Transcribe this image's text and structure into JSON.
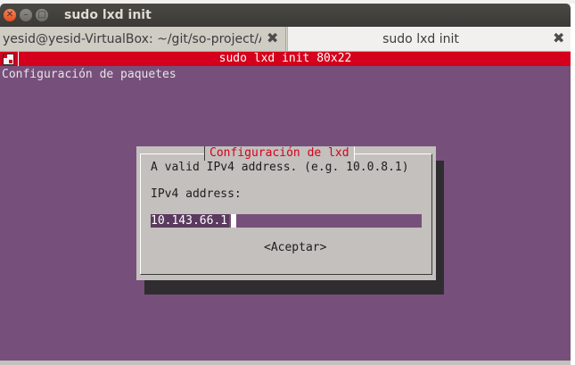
{
  "window": {
    "title": "sudo lxd init",
    "close_glyph": "✕",
    "min_glyph": "–",
    "max_glyph": "□"
  },
  "tabs": [
    {
      "label": "yesid@yesid-VirtualBox: ~/git/so-project/A",
      "close_glyph": "✖"
    },
    {
      "label": "sudo lxd init",
      "close_glyph": "✖"
    }
  ],
  "terminal": {
    "title": "sudo lxd init 80x22",
    "line1": "Configuración de paquetes",
    "colors": {
      "background": "#76507a",
      "titlebar": "#d5001b"
    }
  },
  "dialog": {
    "title": "Configuración de lxd",
    "description": "A valid IPv4 address. (e.g. 10.0.8.1)",
    "field_label": "IPv4 address:",
    "field_value": "10.143.66.1",
    "ok_button": "<Aceptar>"
  }
}
